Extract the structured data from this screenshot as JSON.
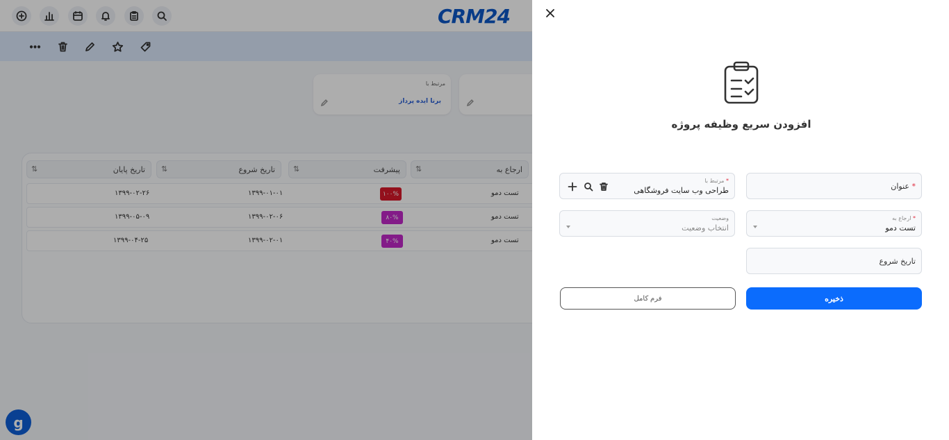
{
  "app": {
    "logo_text": "CRM24",
    "top_icons": [
      "search-icon",
      "clipboard-icon",
      "bell-icon",
      "calendar-icon",
      "chart-icon",
      "plus-circle-icon"
    ],
    "action_icons": [
      "tag-icon",
      "star-icon",
      "pencil-icon",
      "trash-icon",
      "more-icon"
    ],
    "related_card": {
      "label": "مرتبط با",
      "value": "برنا ایده پرداز"
    },
    "table": {
      "headers": [
        "ارجاع به",
        "پیشرفت",
        "تاریخ شروع",
        "تاریخ پایان"
      ],
      "rows": [
        {
          "assignee": "تست دمو",
          "progress": "۱۰۰%",
          "progress_color": "#d9192a",
          "start": "۱۳۹۹-۰۱-۰۱",
          "end": "۱۳۹۹-۰۲-۲۶"
        },
        {
          "assignee": "تست دمو",
          "progress": "۸۰%",
          "progress_color": "#c129c9",
          "start": "۱۳۹۹-۰۲-۰۶",
          "end": "۱۳۹۹-۰۵-۰۹"
        },
        {
          "assignee": "تست دمو",
          "progress": "۴۰%",
          "progress_color": "#c129c9",
          "start": "۱۳۹۹-۰۲-۰۱",
          "end": "۱۳۹۹-۰۴-۲۵"
        }
      ]
    },
    "support_icon": "g"
  },
  "panel": {
    "title": "افزودن سریع وظیفه پروژه",
    "fields": {
      "title": {
        "label": "عنوان",
        "required": "*"
      },
      "related_to": {
        "label": "مرتبط با",
        "required": "*",
        "value": "طراحی وب سایت فروشگاهی"
      },
      "assign_to": {
        "label": "ارجاع به",
        "required": "*",
        "value": "تست دمو"
      },
      "status": {
        "label": "وضعیت",
        "placeholder": "انتخاب وضعیت"
      },
      "start_date": {
        "label": "تاریخ شروع"
      }
    },
    "buttons": {
      "save": "ذخیره",
      "full_form": "فرم کامل"
    }
  },
  "colors": {
    "primary": "#0b6cfd",
    "required": "#e0283c",
    "logo": "#0d57c7"
  }
}
